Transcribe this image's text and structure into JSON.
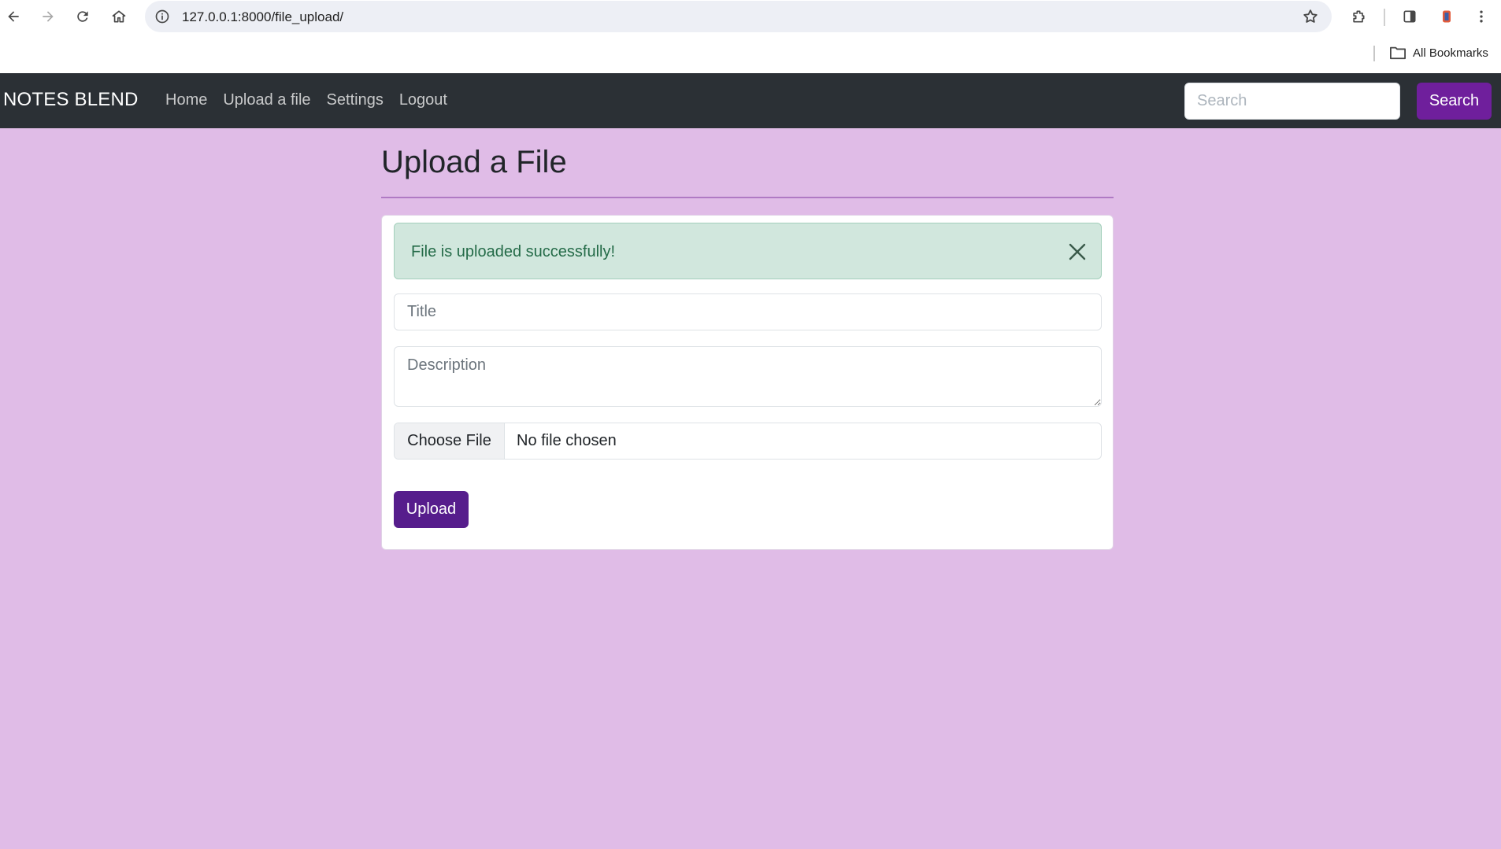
{
  "browser": {
    "url": "127.0.0.1:8000/file_upload/",
    "bookmarks_folder": "All Bookmarks"
  },
  "navbar": {
    "brand": "NOTES BLEND",
    "links": [
      "Home",
      "Upload a file",
      "Settings",
      "Logout"
    ],
    "search_placeholder": "Search",
    "search_button": "Search",
    "accent_color": "#6f1f9c"
  },
  "page": {
    "title": "Upload a File",
    "background_color": "#e0bce7"
  },
  "alert": {
    "message": "File is uploaded successfully!",
    "type": "success"
  },
  "form": {
    "title_placeholder": "Title",
    "title_value": "",
    "description_placeholder": "Description",
    "description_value": "",
    "file_button": "Choose File",
    "file_status": "No file chosen",
    "submit_label": "Upload",
    "submit_color": "#561d8c"
  }
}
